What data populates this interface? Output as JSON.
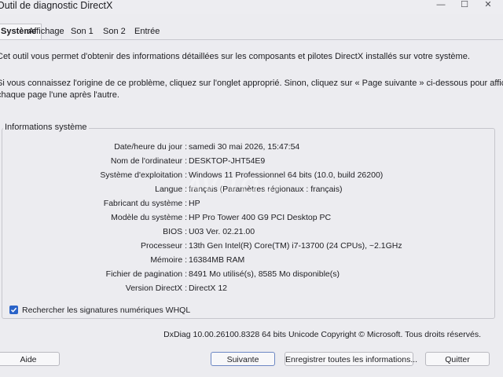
{
  "window": {
    "title": "Outil de diagnostic DirectX",
    "minimize": "—",
    "maximize": "☐",
    "close": "✕"
  },
  "tabs": [
    "Système",
    "Affichage",
    "Son 1",
    "Son 2",
    "Entrée"
  ],
  "intro": {
    "line1": "Cet outil vous permet d'obtenir des informations détaillées sur les composants et pilotes DirectX installés sur votre système.",
    "line2": "Si vous connaissez l'origine de ce problème, cliquez sur l'onglet approprié. Sinon, cliquez sur « Page suivante » ci-dessous pour afficher",
    "line3": "chaque page l'une après l'autre."
  },
  "system_info": {
    "title": "Informations système",
    "rows": [
      {
        "label": "Date/heure du jour :",
        "value": "samedi 30 mai 2026, 15:47:54"
      },
      {
        "label": "Nom de l'ordinateur :",
        "value": "DESKTOP-JHT54E9"
      },
      {
        "label": "Système d'exploitation :",
        "value": "Windows 11 Professionnel 64 bits (10.0, build 26200)"
      },
      {
        "label": "Langue :",
        "value": "français (Paramètres régionaux : français)"
      },
      {
        "label": "Fabricant du système :",
        "value": "HP"
      },
      {
        "label": "Modèle du système :",
        "value": "HP Pro Tower 400 G9 PCI Desktop PC"
      },
      {
        "label": "BIOS :",
        "value": "U03 Ver. 02.21.00"
      },
      {
        "label": "Processeur :",
        "value": "13th Gen Intel(R) Core(TM) i7-13700 (24 CPUs), ~2.1GHz"
      },
      {
        "label": "Mémoire :",
        "value": "16384MB RAM"
      },
      {
        "label": "Fichier de pagination :",
        "value": "8491 Mo utilisé(s), 8585 Mo disponible(s)"
      },
      {
        "label": "Version DirectX :",
        "value": "DirectX 12"
      }
    ]
  },
  "watermark": {
    "main": "AVITO",
    "suffix": ".MA"
  },
  "whql_checkbox": {
    "label": "Rechercher les signatures numériques WHQL",
    "checked": true
  },
  "footer": {
    "copyright": "DxDiag 10.00.26100.8328 64 bits Unicode Copyright © Microsoft. Tous droits réservés."
  },
  "buttons": {
    "help": "Aide",
    "next": "Suivante",
    "save": "Enregistrer toutes les informations...",
    "quit": "Quitter"
  },
  "colors": {
    "accent": "#2a63c8",
    "background": "#ececf0"
  }
}
